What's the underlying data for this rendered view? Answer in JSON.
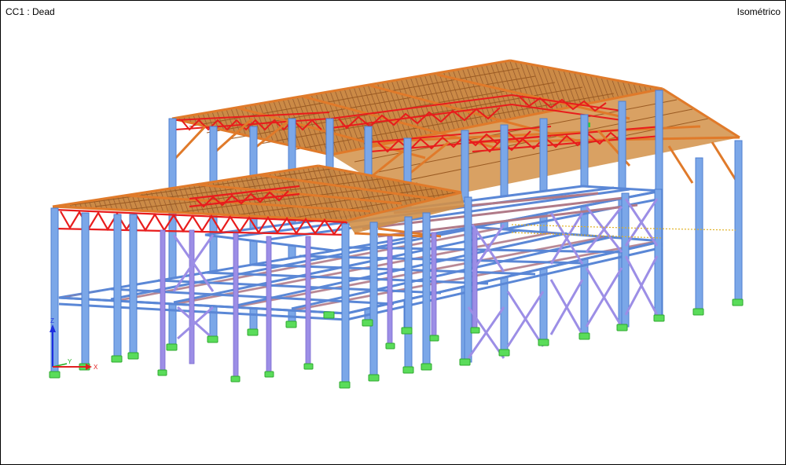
{
  "viewport": {
    "load_case_label": "CC1 : Dead",
    "view_label": "Isométrico"
  },
  "axes": {
    "z_label": "Z",
    "y_label": "Y",
    "x_label": "X"
  },
  "model": {
    "icon": "structure-model",
    "colors": {
      "column": "#7ba7e8",
      "column_edge": "#4f7fd0",
      "brace": "#9c8ee6",
      "beam": "#5a87d6",
      "truss": "#e81c1c",
      "rafter": "#e07a2a",
      "purlin": "#a65a2a",
      "roof": "#c8843c",
      "support": "#5adc5a",
      "dotted": "#e0b020",
      "axis_z": "#1e2ee0",
      "axis_y": "#20b020",
      "axis_x": "#e02020"
    }
  }
}
